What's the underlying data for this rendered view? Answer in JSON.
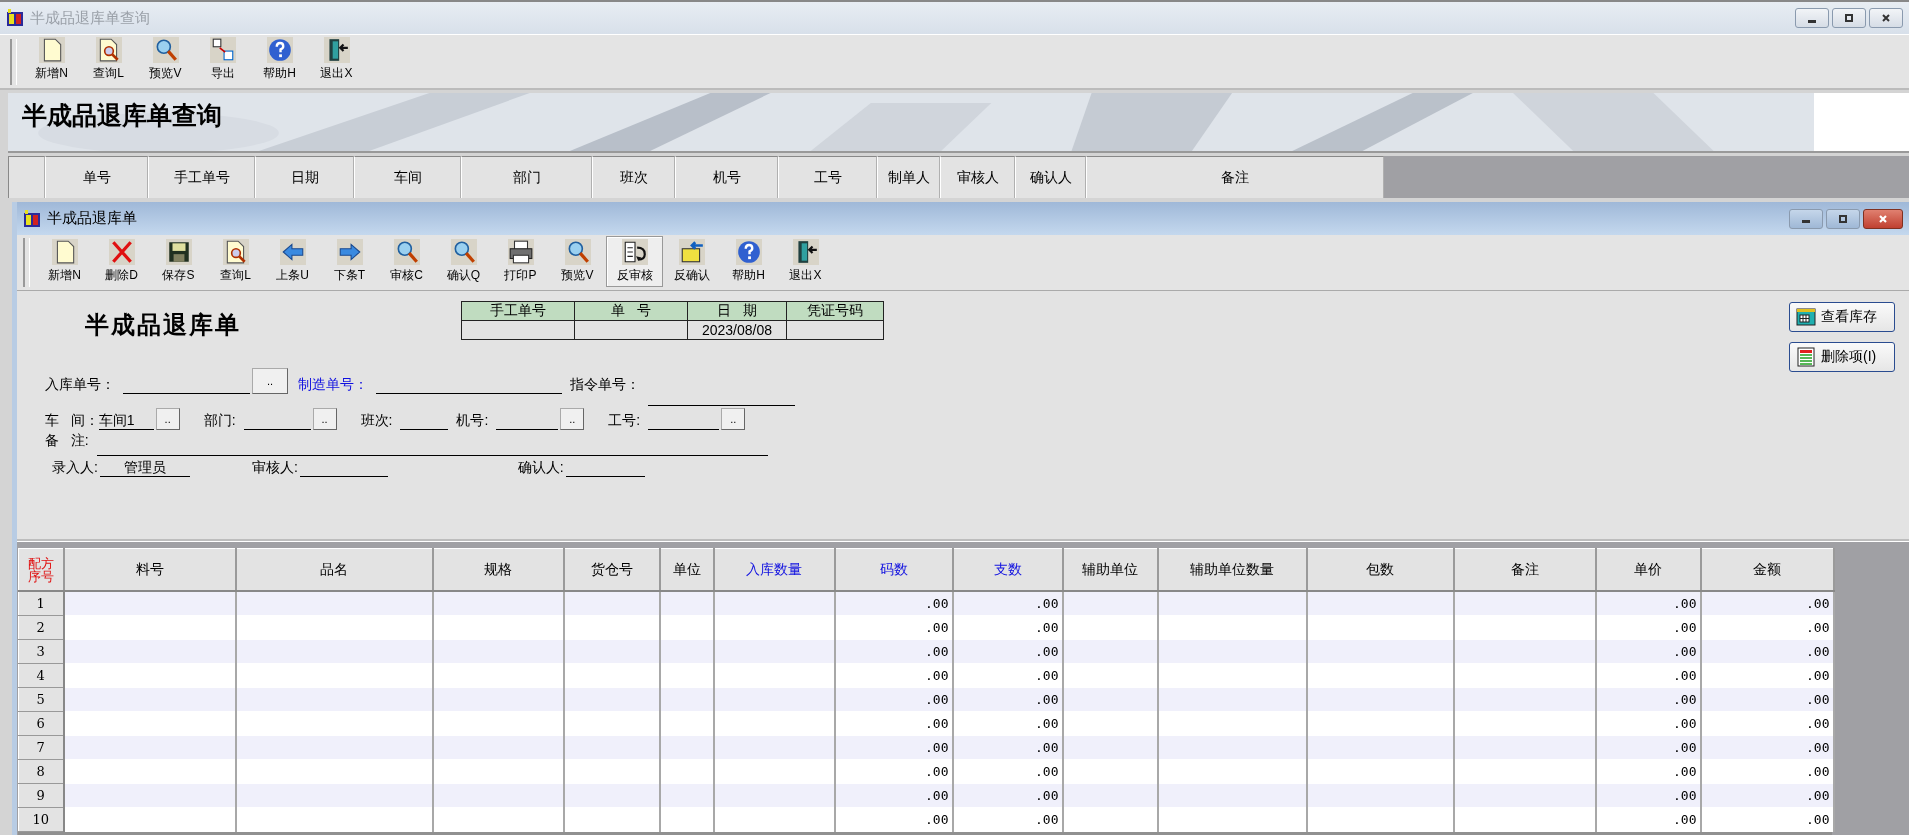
{
  "outer_window": {
    "title": "半成品退库单查询",
    "active": false,
    "toolbar": [
      {
        "label": "新增N",
        "kind": "new"
      },
      {
        "label": "查询L",
        "kind": "query"
      },
      {
        "label": "预览V",
        "kind": "search"
      },
      {
        "label": "导出",
        "kind": "export"
      },
      {
        "label": "帮助H",
        "kind": "help"
      },
      {
        "label": "退出X",
        "kind": "exit"
      }
    ],
    "banner_title": "半成品退库单查询",
    "list_columns": [
      "单号",
      "手工单号",
      "日期",
      "车间",
      "部门",
      "班次",
      "机号",
      "工号",
      "制单人",
      "审核人",
      "确认人",
      "备注"
    ]
  },
  "inner_window": {
    "title": "半成品退库单",
    "active": true,
    "toolbar": [
      {
        "label": "新增N",
        "kind": "new",
        "selected": false
      },
      {
        "label": "删除D",
        "kind": "delete",
        "selected": false
      },
      {
        "label": "保存S",
        "kind": "save",
        "selected": false
      },
      {
        "label": "查询L",
        "kind": "query",
        "selected": false
      },
      {
        "label": "上条U",
        "kind": "prev",
        "selected": false
      },
      {
        "label": "下条T",
        "kind": "next",
        "selected": false
      },
      {
        "label": "审核C",
        "kind": "search",
        "selected": false
      },
      {
        "label": "确认Q",
        "kind": "search",
        "selected": false
      },
      {
        "label": "打印P",
        "kind": "print",
        "selected": false
      },
      {
        "label": "预览V",
        "kind": "search",
        "selected": false
      },
      {
        "label": "反审核",
        "kind": "unreview",
        "selected": true
      },
      {
        "label": "反确认",
        "kind": "unconfirm",
        "selected": false
      },
      {
        "label": "帮助H",
        "kind": "help",
        "selected": false
      },
      {
        "label": "退出X",
        "kind": "exit",
        "selected": false
      }
    ],
    "form_title": "半成品退库单",
    "voucher": [
      {
        "header": "手工单号"
      },
      {
        "header": "单   号"
      },
      {
        "header": "日   期",
        "value": "2023/08/08"
      },
      {
        "header": "凭证号码"
      }
    ],
    "field_rows": [
      {
        "fields": [
          {
            "label": "入库单号：",
            "button": ".."
          },
          {
            "label": "制造单号：",
            "link": true
          },
          {
            "label": "指令单号："
          }
        ]
      },
      {
        "fields": [
          {
            "label": "车   间：",
            "value": "车间1",
            "button": ".."
          },
          {
            "label": "部门:",
            "button": ".."
          },
          {
            "label": "班次:"
          },
          {
            "label": "机号:",
            "button": ".."
          },
          {
            "label": "工号:",
            "button": ".."
          }
        ]
      },
      {
        "fields": [
          {
            "label": "备   注:"
          }
        ]
      },
      {
        "fields": [
          {
            "label": "录入人:",
            "value": "管理员"
          },
          {
            "label": "审核人:"
          },
          {
            "label": "确认人:"
          }
        ]
      }
    ],
    "side_buttons": [
      {
        "label": "查看库存",
        "kind": "grid"
      },
      {
        "label": "删除项(I)",
        "kind": "table"
      }
    ],
    "grid": {
      "corner": "配方序号",
      "columns": [
        {
          "label": "料号",
          "kind": "text",
          "highlight": false
        },
        {
          "label": "品名",
          "kind": "text",
          "highlight": false
        },
        {
          "label": "规格",
          "kind": "text",
          "highlight": false
        },
        {
          "label": "货仓号",
          "kind": "text",
          "highlight": false
        },
        {
          "label": "单位",
          "kind": "text",
          "highlight": false
        },
        {
          "label": "入库数量",
          "kind": "text",
          "highlight": true
        },
        {
          "label": "码数",
          "kind": "number",
          "highlight": true
        },
        {
          "label": "支数",
          "kind": "number",
          "highlight": true
        },
        {
          "label": "辅助单位",
          "kind": "text",
          "highlight": false
        },
        {
          "label": "辅助单位数量",
          "kind": "text",
          "highlight": false
        },
        {
          "label": "包数",
          "kind": "text",
          "highlight": false
        },
        {
          "label": "备注",
          "kind": "text",
          "highlight": false
        },
        {
          "label": "单价",
          "kind": "number",
          "highlight": false
        },
        {
          "label": "金额",
          "kind": "number",
          "highlight": false
        }
      ],
      "rows": [
        {
          "no": "1",
          "numbers": [
            ".00",
            ".00",
            ".00",
            ".00"
          ]
        },
        {
          "no": "2",
          "numbers": [
            ".00",
            ".00",
            ".00",
            ".00"
          ]
        },
        {
          "no": "3",
          "numbers": [
            ".00",
            ".00",
            ".00",
            ".00"
          ]
        },
        {
          "no": "4",
          "numbers": [
            ".00",
            ".00",
            ".00",
            ".00"
          ]
        },
        {
          "no": "5",
          "numbers": [
            ".00",
            ".00",
            ".00",
            ".00"
          ]
        },
        {
          "no": "6",
          "numbers": [
            ".00",
            ".00",
            ".00",
            ".00"
          ]
        },
        {
          "no": "7",
          "numbers": [
            ".00",
            ".00",
            ".00",
            ".00"
          ]
        },
        {
          "no": "8",
          "numbers": [
            ".00",
            ".00",
            ".00",
            ".00"
          ]
        },
        {
          "no": "9",
          "numbers": [
            ".00",
            ".00",
            ".00",
            ".00"
          ]
        },
        {
          "no": "10",
          "numbers": [
            ".00",
            ".00",
            ".00",
            ".00"
          ]
        }
      ]
    }
  }
}
